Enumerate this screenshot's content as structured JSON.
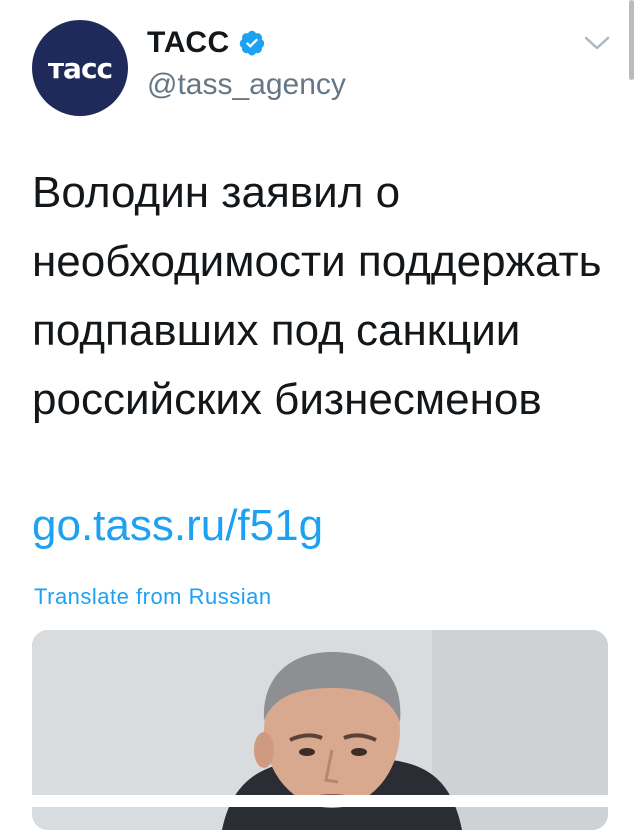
{
  "tweet": {
    "avatar_text": "тасс",
    "display_name": "ТАСС",
    "handle": "@tass_agency",
    "text": "Володин заявил о необходимости поддержать подпавших под санкции российских бизнесменов",
    "link": "go.tass.ru/f51g",
    "translate_label": "Translate from Russian"
  },
  "icons": {
    "verified": "verified-badge-icon",
    "menu": "chevron-down-icon"
  },
  "colors": {
    "link": "#1da1f2",
    "avatar_bg": "#1f2a5a",
    "handle": "#657786"
  }
}
